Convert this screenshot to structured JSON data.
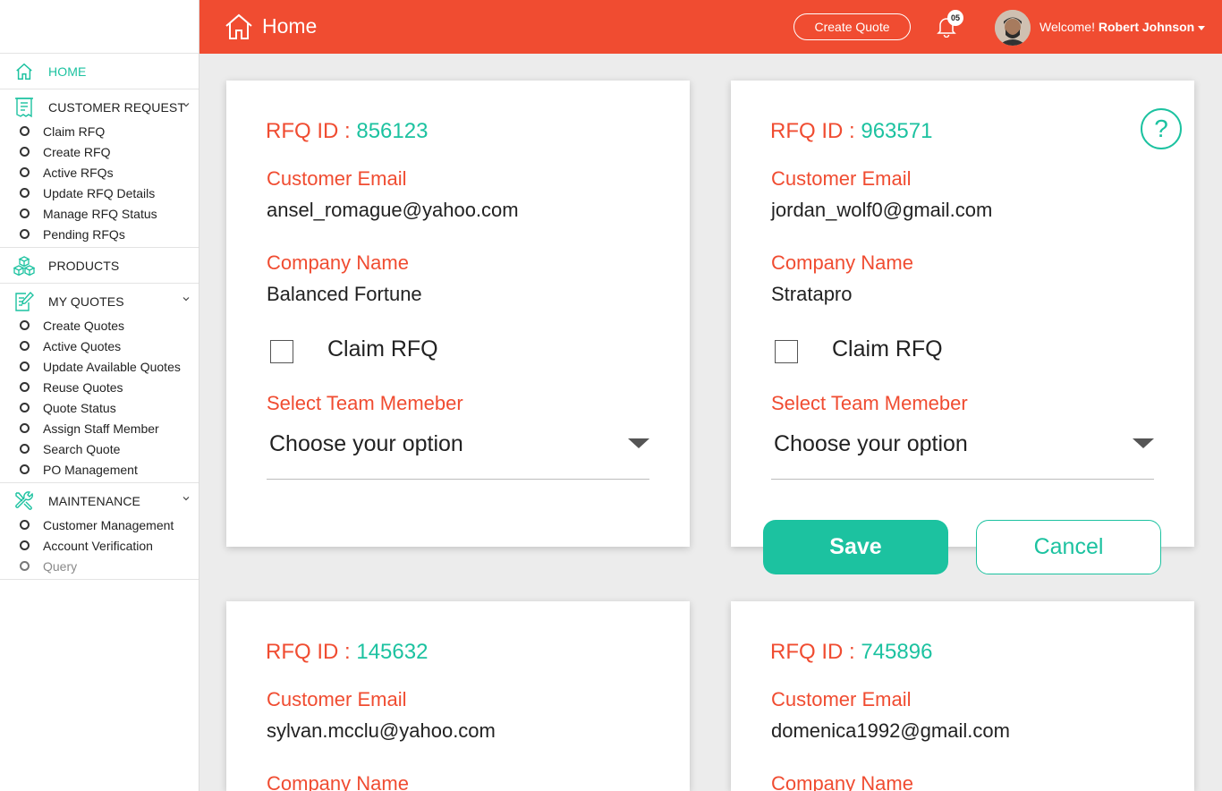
{
  "sidebar": {
    "home": {
      "label": "HOME",
      "icon": "home-icon"
    },
    "sections": [
      {
        "label": "CUSTOMER REQUEST",
        "icon": "receipt-icon",
        "items": [
          "Claim RFQ",
          "Create RFQ",
          "Active RFQs",
          "Update RFQ Details",
          "Manage RFQ Status",
          "Pending RFQs"
        ]
      },
      {
        "label": "PRODUCTS",
        "icon": "boxes-icon",
        "items": []
      },
      {
        "label": "MY QUOTES",
        "icon": "edit-document-icon",
        "items": [
          "Create Quotes",
          "Active Quotes",
          "Update Available Quotes",
          "Reuse Quotes",
          "Quote Status",
          "Assign Staff Member",
          "Search Quote",
          "PO Management"
        ]
      },
      {
        "label": "MAINTENANCE",
        "icon": "tools-icon",
        "items": [
          "Customer Management",
          "Account Verification",
          "Query"
        ]
      }
    ]
  },
  "header": {
    "title": "Home",
    "create_quote_label": "Create Quote",
    "notification_count": "05",
    "welcome_prefix": "Welcome!",
    "user_name": "Robert Johnson"
  },
  "cards": [
    {
      "rfq_label": "RFQ ID : ",
      "rfq_id": "856123",
      "email_label": "Customer Email",
      "email": "ansel_romague@yahoo.com",
      "company_label": "Company Name",
      "company": "Balanced Fortune",
      "claim_label": "Claim RFQ",
      "team_label": "Select Team Memeber",
      "select_placeholder": "Choose your option"
    },
    {
      "rfq_label": "RFQ ID : ",
      "rfq_id": "963571",
      "email_label": "Customer Email",
      "email": "jordan_wolf0@gmail.com",
      "company_label": "Company Name",
      "company": "Stratapro",
      "claim_label": "Claim RFQ",
      "team_label": "Select Team Memeber",
      "select_placeholder": "Choose your option",
      "help": "?"
    },
    {
      "rfq_label": "RFQ ID : ",
      "rfq_id": "145632",
      "email_label": "Customer Email",
      "email": "sylvan.mcclu@yahoo.com",
      "company_label": "Company Name"
    },
    {
      "rfq_label": "RFQ ID : ",
      "rfq_id": "745896",
      "email_label": "Customer Email",
      "email": "domenica1992@gmail.com",
      "company_label": "Company Name"
    }
  ],
  "actions": {
    "save_label": "Save",
    "cancel_label": "Cancel"
  },
  "colors": {
    "brand": "#f04c31",
    "accent": "#1cc2a0"
  }
}
